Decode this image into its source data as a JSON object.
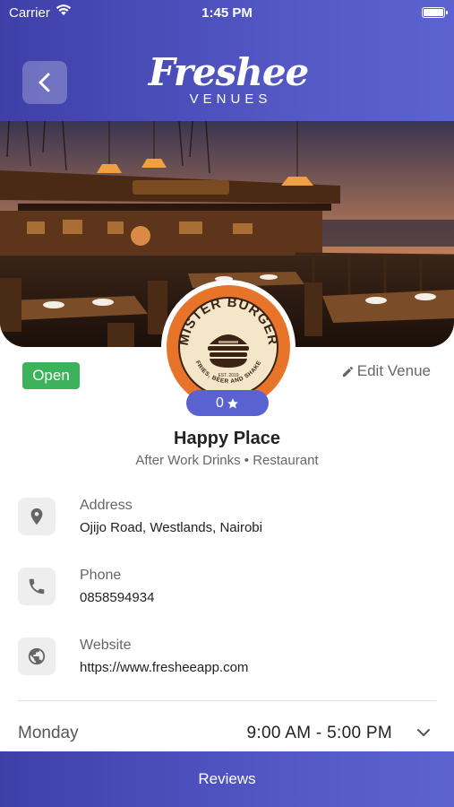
{
  "status_bar": {
    "carrier": "Carrier",
    "time": "1:45 PM"
  },
  "header": {
    "brand": "Freshee",
    "brand_sub": "VENUES",
    "back_icon": "chevron-left-icon"
  },
  "hero": {
    "image": "restaurant-terrace-photo"
  },
  "venue": {
    "logo_text_top": "MISTER BURGER",
    "logo_text_bottom": "FRIES, BEER AND SHAKE",
    "logo_est": "EST. 2019",
    "rating": "0",
    "status": "Open",
    "edit_label": "Edit Venue",
    "name": "Happy Place",
    "categories": "After Work Drinks • Restaurant"
  },
  "details": [
    {
      "icon": "location-pin-icon",
      "label": "Address",
      "value": "Ojijo Road, Westlands, Nairobi"
    },
    {
      "icon": "phone-icon",
      "label": "Phone",
      "value": "0858594934"
    },
    {
      "icon": "globe-icon",
      "label": "Website",
      "value": "https://www.fresheeapp.com"
    }
  ],
  "hours": {
    "day": "Monday",
    "time": "9:00 AM - 5:00 PM"
  },
  "footer": {
    "reviews_label": "Reviews"
  },
  "colors": {
    "accent": "#5a62d2",
    "open_green": "#3cb35a",
    "logo_orange": "#e8742a"
  }
}
